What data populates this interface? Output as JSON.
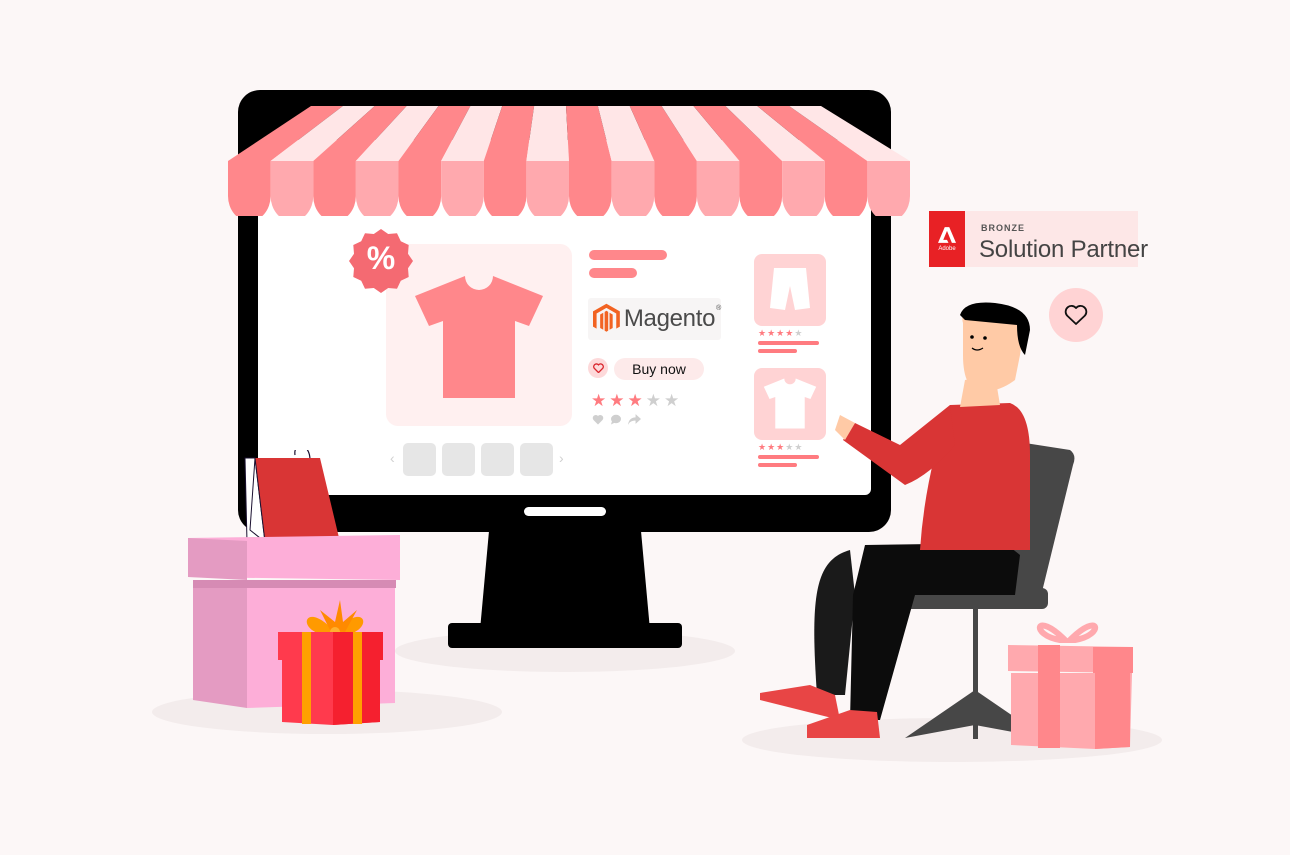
{
  "scene": {
    "description": "Ecommerce storefront illustration on a monitor",
    "colors": {
      "background": "#fcf7f7",
      "accent_pink": "#ff878b",
      "awning_light": "#ffe6e7",
      "awning_mid": "#ffa9ae",
      "shirt": "#ff878b",
      "person_shirt": "#d93535",
      "adobe_red": "#e82125"
    }
  },
  "storefront": {
    "discount_badge": "%",
    "product": {
      "image_icon": "tshirt-icon",
      "thumbnails_count": 4,
      "prev_arrow": "‹",
      "next_arrow": "›"
    },
    "platform_logo": {
      "name": "Magento",
      "trademark": "®"
    },
    "buy_button_label": "Buy now",
    "rating": {
      "value": 3,
      "max": 5
    },
    "actions": [
      "heart-icon",
      "comment-icon",
      "share-icon"
    ],
    "related_products": [
      {
        "icon": "shorts-icon",
        "rating": 4,
        "max": 5
      },
      {
        "icon": "tshirt-icon",
        "rating": 3,
        "max": 5
      }
    ]
  },
  "partner_badge": {
    "brand": "Adobe",
    "tier": "BRONZE",
    "title": "Solution Partner"
  },
  "favorite_bubble": {
    "icon": "heart-outline-icon"
  }
}
